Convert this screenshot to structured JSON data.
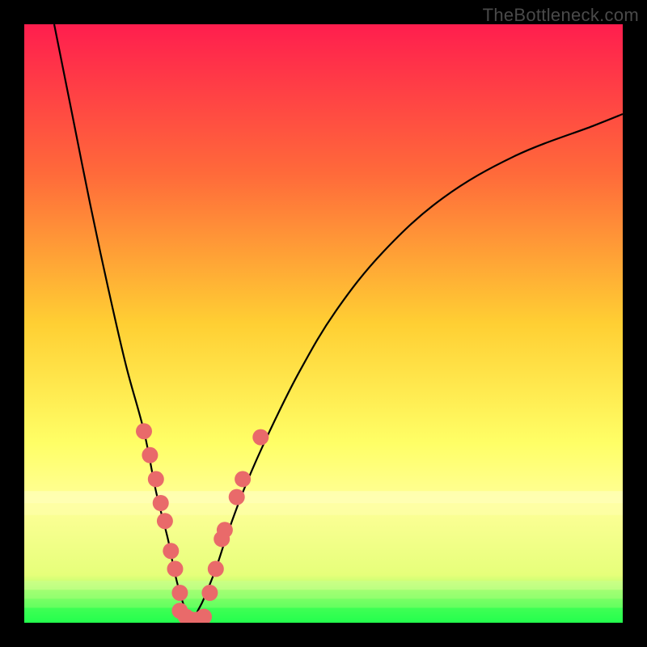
{
  "watermark": "TheBottleneck.com",
  "chart_data": {
    "type": "line",
    "title": "",
    "xlabel": "",
    "ylabel": "",
    "xlim": [
      0,
      100
    ],
    "ylim": [
      0,
      100
    ],
    "background_gradient": {
      "stops": [
        {
          "offset": 0,
          "color": "#ff1e4e"
        },
        {
          "offset": 25,
          "color": "#ff6a3a"
        },
        {
          "offset": 50,
          "color": "#ffcf33"
        },
        {
          "offset": 70,
          "color": "#ffff66"
        },
        {
          "offset": 80,
          "color": "#ffff99"
        },
        {
          "offset": 92,
          "color": "#e6ff7a"
        },
        {
          "offset": 96,
          "color": "#8cff66"
        },
        {
          "offset": 100,
          "color": "#1fff4a"
        }
      ]
    },
    "series": [
      {
        "name": "curve-left",
        "x": [
          5,
          8,
          11,
          14,
          17,
          20,
          22,
          24,
          25,
          26,
          27,
          28
        ],
        "y": [
          100,
          85,
          70,
          56,
          43,
          32,
          22,
          14,
          9,
          5,
          2,
          0
        ]
      },
      {
        "name": "curve-right",
        "x": [
          28,
          29,
          30,
          32,
          34,
          37,
          41,
          46,
          52,
          60,
          70,
          82,
          95,
          100
        ],
        "y": [
          0,
          2,
          4,
          9,
          15,
          23,
          32,
          42,
          52,
          62,
          71,
          78,
          83,
          85
        ]
      }
    ],
    "scatter": {
      "name": "dots",
      "color": "#e96a6a",
      "points": [
        {
          "x": 20.0,
          "y": 32.0
        },
        {
          "x": 21.0,
          "y": 28.0
        },
        {
          "x": 22.0,
          "y": 24.0
        },
        {
          "x": 22.8,
          "y": 20.0
        },
        {
          "x": 23.5,
          "y": 17.0
        },
        {
          "x": 24.5,
          "y": 12.0
        },
        {
          "x": 25.2,
          "y": 9.0
        },
        {
          "x": 26.0,
          "y": 5.0
        },
        {
          "x": 26.0,
          "y": 2.0
        },
        {
          "x": 27.0,
          "y": 1.0
        },
        {
          "x": 28.0,
          "y": 0.5
        },
        {
          "x": 29.0,
          "y": 0.5
        },
        {
          "x": 30.0,
          "y": 1.0
        },
        {
          "x": 31.0,
          "y": 5.0
        },
        {
          "x": 32.0,
          "y": 9.0
        },
        {
          "x": 33.0,
          "y": 14.0
        },
        {
          "x": 33.5,
          "y": 15.5
        },
        {
          "x": 35.5,
          "y": 21.0
        },
        {
          "x": 36.5,
          "y": 24.0
        },
        {
          "x": 39.5,
          "y": 31.0
        }
      ]
    }
  }
}
